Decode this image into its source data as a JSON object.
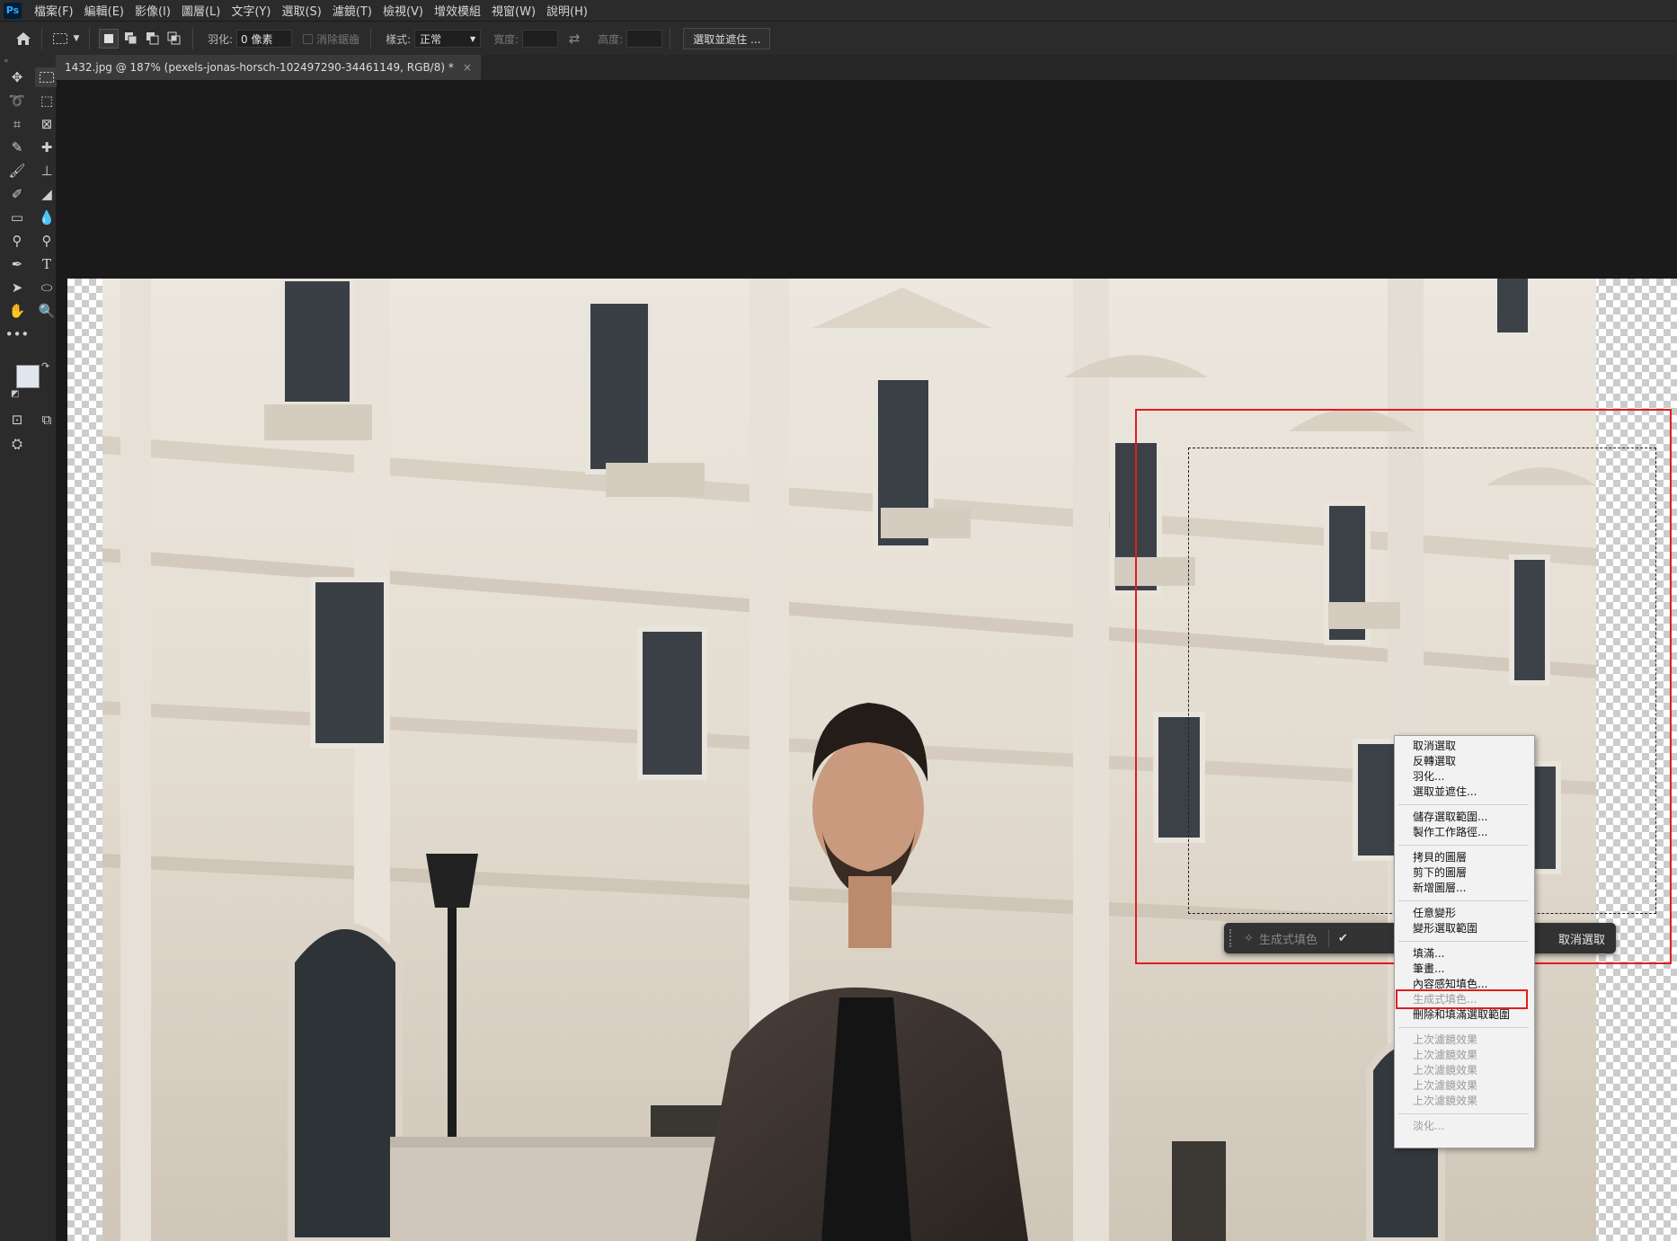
{
  "app": {
    "logo": "Ps"
  },
  "menubar": {
    "items": [
      "檔案(F)",
      "編輯(E)",
      "影像(I)",
      "圖層(L)",
      "文字(Y)",
      "選取(S)",
      "濾鏡(T)",
      "檢視(V)",
      "增效模組",
      "視窗(W)",
      "說明(H)"
    ]
  },
  "options": {
    "home_icon": "home-icon",
    "feather_label": "羽化:",
    "feather_value": "0 像素",
    "antialias_label": "消除鋸齒",
    "style_label": "樣式:",
    "style_value": "正常",
    "width_label": "寬度:",
    "height_label": "高度:",
    "select_mask_button": "選取並遮住 ..."
  },
  "document": {
    "tab_title": "1432.jpg @ 187% (pexels-jonas-horsch-102497290-34461149, RGB/8) *",
    "close": "×"
  },
  "taskbar": {
    "generative_fill": "生成式填色",
    "deselect": "取消選取"
  },
  "context_menu": {
    "groups": [
      [
        "取消選取",
        "反轉選取",
        "羽化...",
        "選取並遮住..."
      ],
      [
        "儲存選取範圍...",
        "製作工作路徑..."
      ],
      [
        "拷貝的圖層",
        "剪下的圖層",
        "新增圖層..."
      ],
      [
        "任意變形",
        "變形選取範圍"
      ],
      [
        "填滿...",
        "筆畫...",
        "內容感知填色...",
        "生成式填色...",
        "刪除和填滿選取範圍"
      ],
      [
        "上次濾鏡效果",
        "上次濾鏡效果",
        "上次濾鏡效果",
        "上次濾鏡效果",
        "上次濾鏡效果"
      ],
      [
        "淡化..."
      ]
    ],
    "highlighted_item": "生成式填色..."
  },
  "colors": {
    "annotation_red": "#e11d1d",
    "ui_dark": "#2b2b2b",
    "menu_bg": "#f2f2f2",
    "foreground_swatch": "#dfe6ee",
    "background_swatch": "#c9b9a1"
  }
}
